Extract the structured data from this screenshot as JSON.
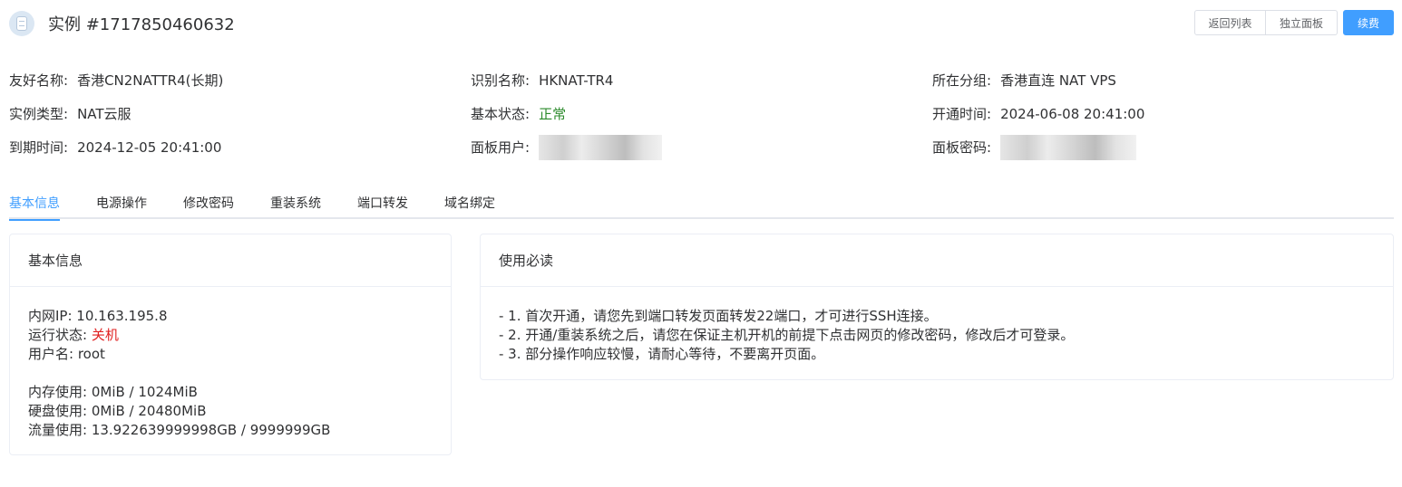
{
  "header": {
    "title": "实例 #1717850460632",
    "buttons": {
      "back": "返回列表",
      "panel": "独立面板",
      "renew": "续费"
    }
  },
  "info": {
    "friendly_name": {
      "label": "友好名称:",
      "value": "香港CN2NATTR4(长期)"
    },
    "id_name": {
      "label": "识别名称:",
      "value": "HKNAT-TR4"
    },
    "group": {
      "label": "所在分组:",
      "value": "香港直连 NAT VPS"
    },
    "type": {
      "label": "实例类型:",
      "value": "NAT云服"
    },
    "status": {
      "label": "基本状态:",
      "value": "正常"
    },
    "open_time": {
      "label": "开通时间:",
      "value": "2024-06-08 20:41:00"
    },
    "expire_time": {
      "label": "到期时间:",
      "value": "2024-12-05 20:41:00"
    },
    "panel_user": {
      "label_selected": "面板用户",
      "label_rest": ":"
    },
    "panel_password": {
      "label": "面板密码:"
    }
  },
  "tabs": [
    "基本信息",
    "电源操作",
    "修改密码",
    "重装系统",
    "端口转发",
    "域名绑定"
  ],
  "basic_card": {
    "title": "基本信息",
    "ip": {
      "label": "内网IP: ",
      "value": "10.163.195.8"
    },
    "run_status": {
      "label": "运行状态: ",
      "value": "关机"
    },
    "username": {
      "label": "用户名: ",
      "value": "root"
    },
    "memory": {
      "label": "内存使用: ",
      "value": "0MiB / 1024MiB"
    },
    "disk": {
      "label": "硬盘使用: ",
      "value": "0MiB / 20480MiB"
    },
    "traffic": {
      "label": "流量使用: ",
      "value": "13.922639999998GB / 9999999GB"
    }
  },
  "notice_card": {
    "title": "使用必读",
    "items": [
      "- 1. 首次开通，请您先到端口转发页面转发22端口，才可进行SSH连接。",
      "- 2. 开通/重装系统之后，请您在保证主机开机的前提下点击网页的修改密码，修改后才可登录。",
      "- 3. 部分操作响应较慢，请耐心等待，不要离开页面。"
    ]
  },
  "colors": {
    "accent": "#409eff",
    "ok": "#2b8a2b",
    "danger": "#e02020",
    "selection": "#2f6bd6"
  }
}
